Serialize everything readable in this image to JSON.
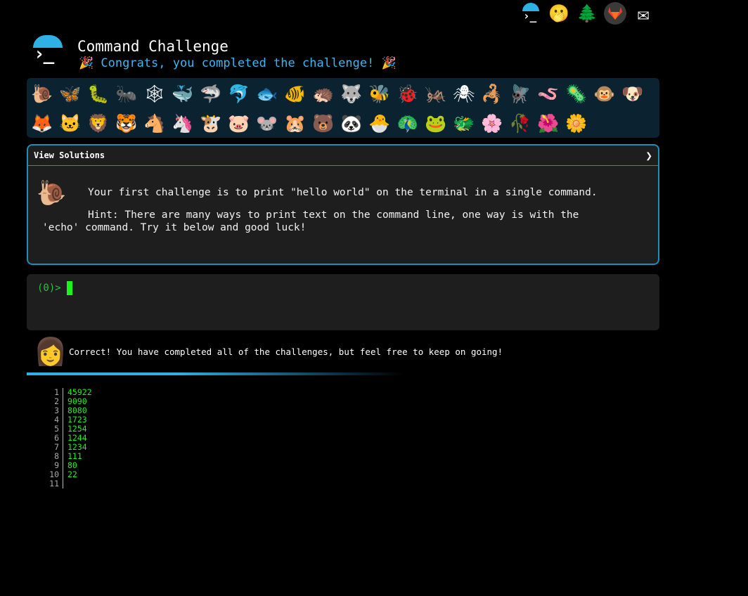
{
  "topnav": {
    "items": [
      {
        "name": "terminal-logo-icon",
        "glyph": "›_"
      },
      {
        "name": "face-with-hand-over-mouth-icon",
        "glyph": "🫢"
      },
      {
        "name": "evergreen-tree-icon",
        "glyph": "🌲"
      },
      {
        "name": "gitlab-icon",
        "glyph": "🦊"
      },
      {
        "name": "envelope-icon",
        "glyph": "✉"
      }
    ]
  },
  "header": {
    "title": "Command Challenge",
    "congrats": "🎉 Congrats, you completed the challenge! 🎉"
  },
  "emoji_grid": {
    "row1": [
      "🐌",
      "🦋",
      "🐛",
      "🐜",
      "🕸",
      "🐳",
      "🦈",
      "🐬",
      "🐟",
      "🐠",
      "🦔",
      "🐺",
      "🐝",
      "🐞",
      "🦗",
      "🕷",
      "🦂",
      "🪰",
      "🪱",
      "🦠",
      "🐵",
      "🐶"
    ],
    "row2": [
      "🦊",
      "🐱",
      "🦁",
      "🐯",
      "🐴",
      "🦄",
      "🐮",
      "🐷",
      "🐭",
      "🐹",
      "🐻",
      "🐼",
      "🐣",
      "🦚",
      "🐸",
      "🐲",
      "🌸",
      "🥀",
      "🌺",
      "🌼"
    ]
  },
  "challenge": {
    "view_solutions_label": "View Solutions",
    "chevron_glyph": "❯",
    "snail_glyph": "🐌",
    "text_line1": "Your first challenge is to print \"hello world\" on the terminal in a single command.",
    "text_line2": "Hint: There are many ways to print text on the command line, one way is with the 'echo' command. Try it below and good luck!"
  },
  "terminal": {
    "prompt": "(0)>"
  },
  "feedback": {
    "avatar_glyph": "👩",
    "message": "Correct! You have completed all of the challenges, but feel free to keep on going!"
  },
  "progress": {
    "fraction": 1.0
  },
  "output": {
    "lines": [
      {
        "n": "1",
        "v": "45922"
      },
      {
        "n": "2",
        "v": "9090"
      },
      {
        "n": "3",
        "v": "8080"
      },
      {
        "n": "4",
        "v": "1723"
      },
      {
        "n": "5",
        "v": "1254"
      },
      {
        "n": "6",
        "v": "1244"
      },
      {
        "n": "7",
        "v": "1234"
      },
      {
        "n": "8",
        "v": "111"
      },
      {
        "n": "9",
        "v": "80"
      },
      {
        "n": "10",
        "v": "22"
      },
      {
        "n": "11",
        "v": ""
      }
    ]
  }
}
